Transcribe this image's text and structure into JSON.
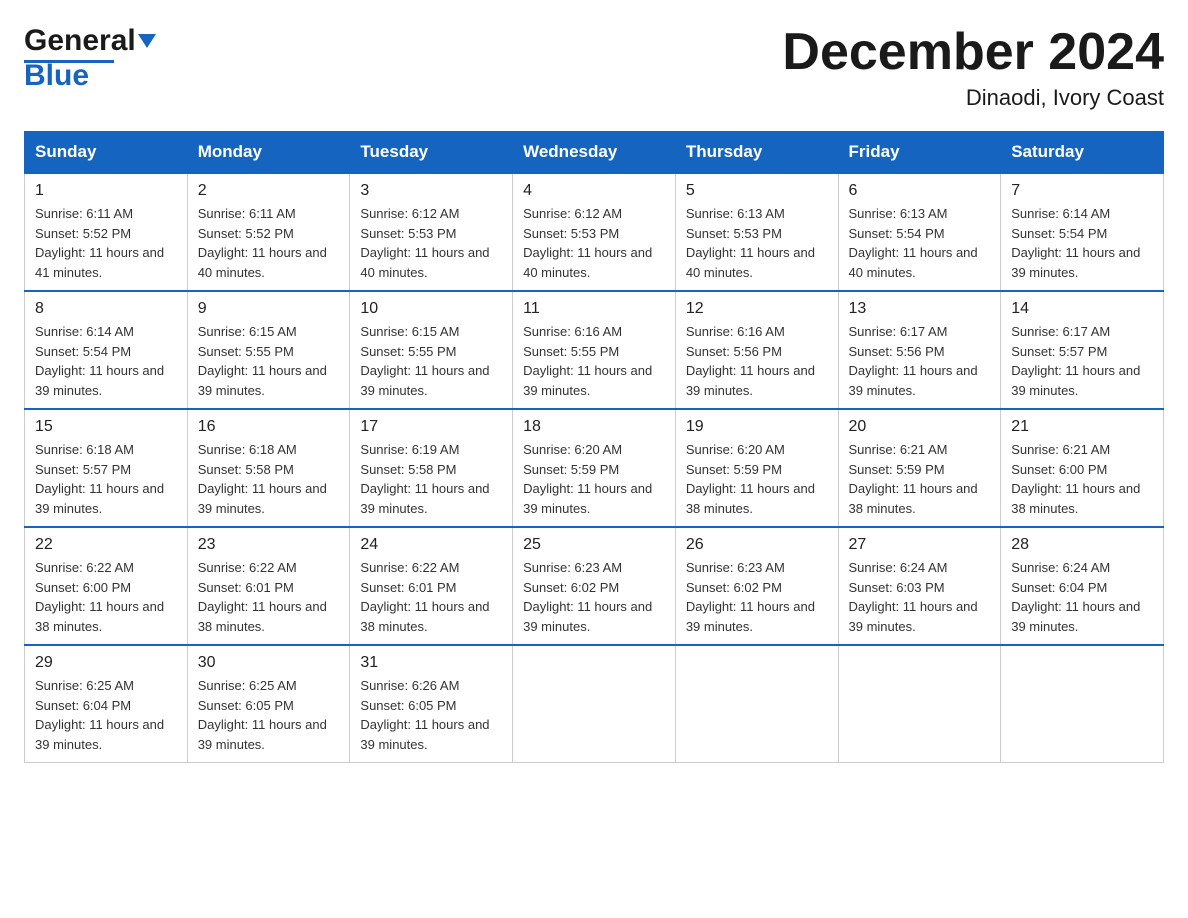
{
  "logo": {
    "general": "General",
    "blue": "Blue"
  },
  "title": "December 2024",
  "location": "Dinaodi, Ivory Coast",
  "days_of_week": [
    "Sunday",
    "Monday",
    "Tuesday",
    "Wednesday",
    "Thursday",
    "Friday",
    "Saturday"
  ],
  "weeks": [
    [
      {
        "day": 1,
        "sunrise": "6:11 AM",
        "sunset": "5:52 PM",
        "daylight": "11 hours and 41 minutes."
      },
      {
        "day": 2,
        "sunrise": "6:11 AM",
        "sunset": "5:52 PM",
        "daylight": "11 hours and 40 minutes."
      },
      {
        "day": 3,
        "sunrise": "6:12 AM",
        "sunset": "5:53 PM",
        "daylight": "11 hours and 40 minutes."
      },
      {
        "day": 4,
        "sunrise": "6:12 AM",
        "sunset": "5:53 PM",
        "daylight": "11 hours and 40 minutes."
      },
      {
        "day": 5,
        "sunrise": "6:13 AM",
        "sunset": "5:53 PM",
        "daylight": "11 hours and 40 minutes."
      },
      {
        "day": 6,
        "sunrise": "6:13 AM",
        "sunset": "5:54 PM",
        "daylight": "11 hours and 40 minutes."
      },
      {
        "day": 7,
        "sunrise": "6:14 AM",
        "sunset": "5:54 PM",
        "daylight": "11 hours and 39 minutes."
      }
    ],
    [
      {
        "day": 8,
        "sunrise": "6:14 AM",
        "sunset": "5:54 PM",
        "daylight": "11 hours and 39 minutes."
      },
      {
        "day": 9,
        "sunrise": "6:15 AM",
        "sunset": "5:55 PM",
        "daylight": "11 hours and 39 minutes."
      },
      {
        "day": 10,
        "sunrise": "6:15 AM",
        "sunset": "5:55 PM",
        "daylight": "11 hours and 39 minutes."
      },
      {
        "day": 11,
        "sunrise": "6:16 AM",
        "sunset": "5:55 PM",
        "daylight": "11 hours and 39 minutes."
      },
      {
        "day": 12,
        "sunrise": "6:16 AM",
        "sunset": "5:56 PM",
        "daylight": "11 hours and 39 minutes."
      },
      {
        "day": 13,
        "sunrise": "6:17 AM",
        "sunset": "5:56 PM",
        "daylight": "11 hours and 39 minutes."
      },
      {
        "day": 14,
        "sunrise": "6:17 AM",
        "sunset": "5:57 PM",
        "daylight": "11 hours and 39 minutes."
      }
    ],
    [
      {
        "day": 15,
        "sunrise": "6:18 AM",
        "sunset": "5:57 PM",
        "daylight": "11 hours and 39 minutes."
      },
      {
        "day": 16,
        "sunrise": "6:18 AM",
        "sunset": "5:58 PM",
        "daylight": "11 hours and 39 minutes."
      },
      {
        "day": 17,
        "sunrise": "6:19 AM",
        "sunset": "5:58 PM",
        "daylight": "11 hours and 39 minutes."
      },
      {
        "day": 18,
        "sunrise": "6:20 AM",
        "sunset": "5:59 PM",
        "daylight": "11 hours and 39 minutes."
      },
      {
        "day": 19,
        "sunrise": "6:20 AM",
        "sunset": "5:59 PM",
        "daylight": "11 hours and 38 minutes."
      },
      {
        "day": 20,
        "sunrise": "6:21 AM",
        "sunset": "5:59 PM",
        "daylight": "11 hours and 38 minutes."
      },
      {
        "day": 21,
        "sunrise": "6:21 AM",
        "sunset": "6:00 PM",
        "daylight": "11 hours and 38 minutes."
      }
    ],
    [
      {
        "day": 22,
        "sunrise": "6:22 AM",
        "sunset": "6:00 PM",
        "daylight": "11 hours and 38 minutes."
      },
      {
        "day": 23,
        "sunrise": "6:22 AM",
        "sunset": "6:01 PM",
        "daylight": "11 hours and 38 minutes."
      },
      {
        "day": 24,
        "sunrise": "6:22 AM",
        "sunset": "6:01 PM",
        "daylight": "11 hours and 38 minutes."
      },
      {
        "day": 25,
        "sunrise": "6:23 AM",
        "sunset": "6:02 PM",
        "daylight": "11 hours and 39 minutes."
      },
      {
        "day": 26,
        "sunrise": "6:23 AM",
        "sunset": "6:02 PM",
        "daylight": "11 hours and 39 minutes."
      },
      {
        "day": 27,
        "sunrise": "6:24 AM",
        "sunset": "6:03 PM",
        "daylight": "11 hours and 39 minutes."
      },
      {
        "day": 28,
        "sunrise": "6:24 AM",
        "sunset": "6:04 PM",
        "daylight": "11 hours and 39 minutes."
      }
    ],
    [
      {
        "day": 29,
        "sunrise": "6:25 AM",
        "sunset": "6:04 PM",
        "daylight": "11 hours and 39 minutes."
      },
      {
        "day": 30,
        "sunrise": "6:25 AM",
        "sunset": "6:05 PM",
        "daylight": "11 hours and 39 minutes."
      },
      {
        "day": 31,
        "sunrise": "6:26 AM",
        "sunset": "6:05 PM",
        "daylight": "11 hours and 39 minutes."
      },
      null,
      null,
      null,
      null
    ]
  ]
}
